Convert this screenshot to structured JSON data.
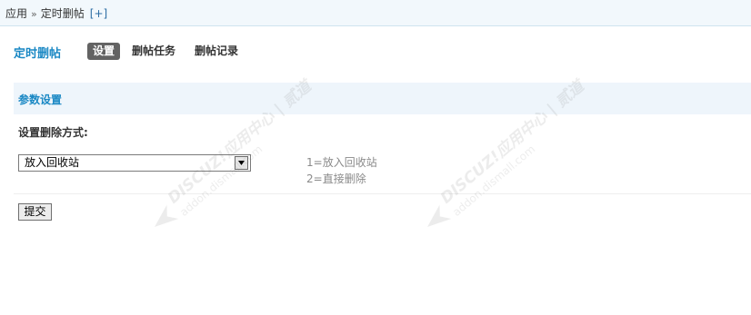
{
  "breadcrumb": {
    "root": "应用",
    "separator": "»",
    "current": "定时删帖",
    "add_label": "[+]"
  },
  "nav": {
    "title": "定时删帖",
    "tabs": [
      {
        "label": "设置",
        "active": true
      },
      {
        "label": "删帖任务",
        "active": false
      },
      {
        "label": "删帖记录",
        "active": false
      }
    ]
  },
  "section": {
    "title": "参数设置"
  },
  "setting": {
    "label": "设置删除方式:",
    "selected": "放入回收站",
    "hint_lines": [
      "1=放入回收站",
      "2=直接删除"
    ]
  },
  "submit_label": "提交",
  "watermark": {
    "brand": "DISCUZ!应用中心 | 贰道",
    "url": "addon.dismall.com"
  },
  "colors": {
    "accent": "#1a88c4",
    "tab_active_bg": "#636363",
    "section_bg": "#eef5fb",
    "topbar_bg": "#f2f8fc"
  }
}
